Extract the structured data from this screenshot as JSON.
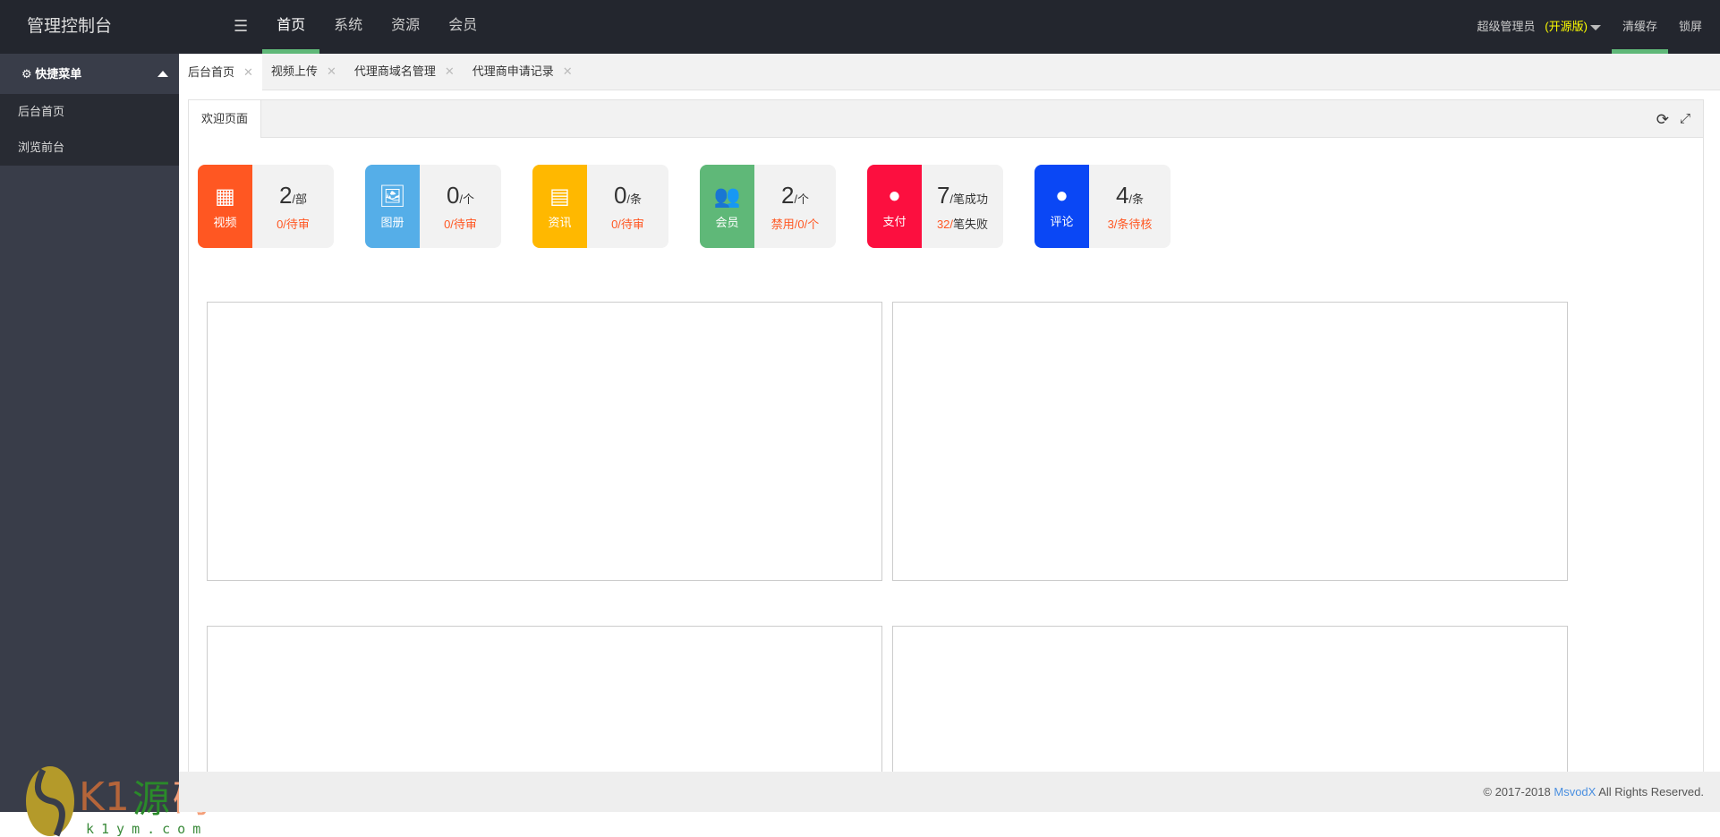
{
  "header": {
    "title": "管理控制台",
    "nav": [
      "首页",
      "系统",
      "资源",
      "会员"
    ],
    "user": "超级管理员",
    "version": "(开源版)",
    "clear_cache": "清缓存",
    "lock": "锁屏"
  },
  "sidebar": {
    "title": "快捷菜单",
    "items": [
      "后台首页",
      "浏览前台"
    ],
    "watermark": "K1源码 k1ym.com"
  },
  "tabs": [
    "后台首页",
    "视频上传",
    "代理商域名管理",
    "代理商申请记录"
  ],
  "panel": {
    "tab": "欢迎页面"
  },
  "cards": [
    {
      "label": "视频",
      "num": "2",
      "unit": "/部",
      "sub": "0/待审",
      "color": "#ff5722"
    },
    {
      "label": "图册",
      "num": "0",
      "unit": "/个",
      "sub": "0/待审",
      "color": "#55aee8"
    },
    {
      "label": "资讯",
      "num": "0",
      "unit": "/条",
      "sub": "0/待审",
      "color": "#ffb800"
    },
    {
      "label": "会员",
      "num": "2",
      "unit": "/个",
      "sub": "禁用/0/个",
      "color": "#5fb878"
    },
    {
      "label": "支付",
      "num": "7",
      "unit": "/笔成功",
      "sub": "32/",
      "sub2": "笔失败",
      "color": "#fc0f3f"
    },
    {
      "label": "评论",
      "num": "4",
      "unit": "/条",
      "sub": "3/条待核",
      "color": "#0a47f5"
    }
  ],
  "footer": {
    "copy": "© 2017-2018 ",
    "brand": "MsvodX",
    "rest": " All Rights Reserved."
  }
}
